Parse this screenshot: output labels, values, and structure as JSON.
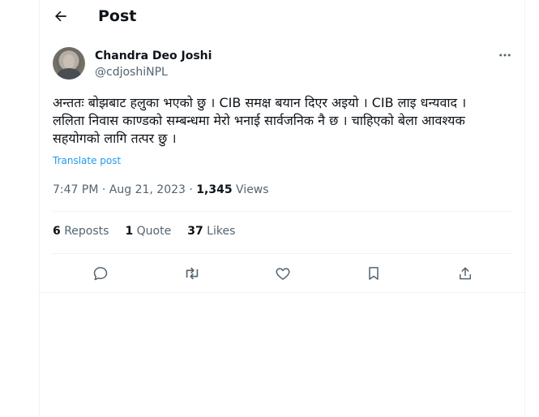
{
  "header": {
    "title": "Post",
    "back_icon": "arrow-left-icon"
  },
  "author": {
    "display_name": "Chandra Deo Joshi",
    "handle": "@cdjoshiNPL",
    "more_icon": "more-horizontal-icon"
  },
  "post": {
    "text_lines": [
      "अन्ततः बोझबाट हलुका भएको छु । CIB समक्ष बयान दिएर अइयो । CIB लाइ धन्यवाद ।",
      "ललिता निवास काण्डको सम्बन्धमा मेरो भनाई सार्वजनिक नै छ । चाहिएको बेला आवश्यक",
      "सहयोगको लागि तत्पर छु ।"
    ],
    "translate_label": "Translate post",
    "time": "7:47 PM",
    "date": "Aug 21, 2023",
    "separator": "·",
    "views_count": "1,345",
    "views_label": "Views"
  },
  "stats": {
    "reposts_count": "6",
    "reposts_label": "Reposts",
    "quotes_count": "1",
    "quotes_label": "Quote",
    "likes_count": "37",
    "likes_label": "Likes"
  },
  "actions": [
    "reply-icon",
    "repost-icon",
    "like-icon",
    "bookmark-icon",
    "share-icon"
  ],
  "colors": {
    "text": "#0f1419",
    "secondary": "#536471",
    "link": "#1d9bf0",
    "border": "#eff3f4"
  }
}
